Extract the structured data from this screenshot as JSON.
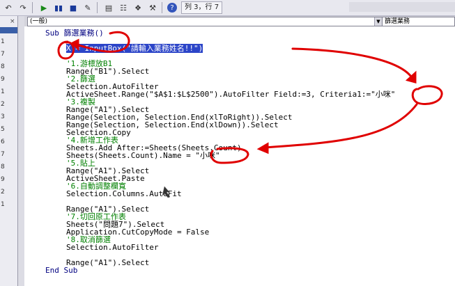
{
  "toolbar": {
    "icons": [
      "undo-icon",
      "redo-icon",
      "run-icon",
      "pause-icon",
      "stop-icon",
      "design-mode-icon",
      "project-explorer-icon",
      "properties-icon",
      "object-browser-icon",
      "toolbox-icon",
      "help-icon"
    ],
    "cursor_position": "列 3，行 7"
  },
  "combos": {
    "object": "(一般)",
    "procedure": "篩選業務"
  },
  "left_pane": {
    "items": [
      "1",
      "7",
      "8",
      "9",
      "1",
      "2",
      "3",
      "5",
      "6",
      "7",
      "8",
      "9",
      "2",
      "1"
    ]
  },
  "code": [
    {
      "text": "Sub 篩選業務()",
      "type": "kw"
    },
    {
      "text": "",
      "type": "plain"
    },
    {
      "text": "X = InputBox(\"請輸入業務姓名!!\")",
      "type": "sel"
    },
    {
      "text": "",
      "type": "plain"
    },
    {
      "text": "'1.游標放B1",
      "type": "cmt"
    },
    {
      "text": "Range(\"B1\").Select",
      "type": "plain"
    },
    {
      "text": "'2.篩選",
      "type": "cmt"
    },
    {
      "text": "Selection.AutoFilter",
      "type": "plain"
    },
    {
      "text": "ActiveSheet.Range(\"$A$1:$L$2500\").AutoFilter Field:=3, Criteria1:=\"小咪\"",
      "type": "plain"
    },
    {
      "text": "'3.複製",
      "type": "cmt"
    },
    {
      "text": "Range(\"A1\").Select",
      "type": "plain"
    },
    {
      "text": "Range(Selection, Selection.End(xlToRight)).Select",
      "type": "plain"
    },
    {
      "text": "Range(Selection, Selection.End(xlDown)).Select",
      "type": "plain"
    },
    {
      "text": "Selection.Copy",
      "type": "plain"
    },
    {
      "text": "'4.新增工作表",
      "type": "cmt"
    },
    {
      "text": "Sheets.Add After:=Sheets(Sheets.Count)",
      "type": "plain"
    },
    {
      "text": "Sheets(Sheets.Count).Name = \"小咪\"",
      "type": "plain"
    },
    {
      "text": "'5.貼上",
      "type": "cmt"
    },
    {
      "text": "Range(\"A1\").Select",
      "type": "plain"
    },
    {
      "text": "ActiveSheet.Paste",
      "type": "plain"
    },
    {
      "text": "'6.自動調整欄寬",
      "type": "cmt"
    },
    {
      "text": "Selection.Columns.AutoFit",
      "type": "plain"
    },
    {
      "text": "",
      "type": "plain"
    },
    {
      "text": "Range(\"A1\").Select",
      "type": "plain"
    },
    {
      "text": "'7.切回原工作表",
      "type": "cmt"
    },
    {
      "text": "Sheets(\"問題7\").Select",
      "type": "plain"
    },
    {
      "text": "Application.CutCopyMode = False",
      "type": "plain"
    },
    {
      "text": "'8.取消篩選",
      "type": "cmt"
    },
    {
      "text": "Selection.AutoFilter",
      "type": "plain"
    },
    {
      "text": "",
      "type": "plain"
    },
    {
      "text": "Range(\"A1\").Select",
      "type": "plain"
    },
    {
      "text": "End Sub",
      "type": "kw"
    }
  ],
  "colors": {
    "keyword": "#000080",
    "comment": "#008000",
    "selection": "#2c45c8",
    "annotation": "#e00000"
  }
}
